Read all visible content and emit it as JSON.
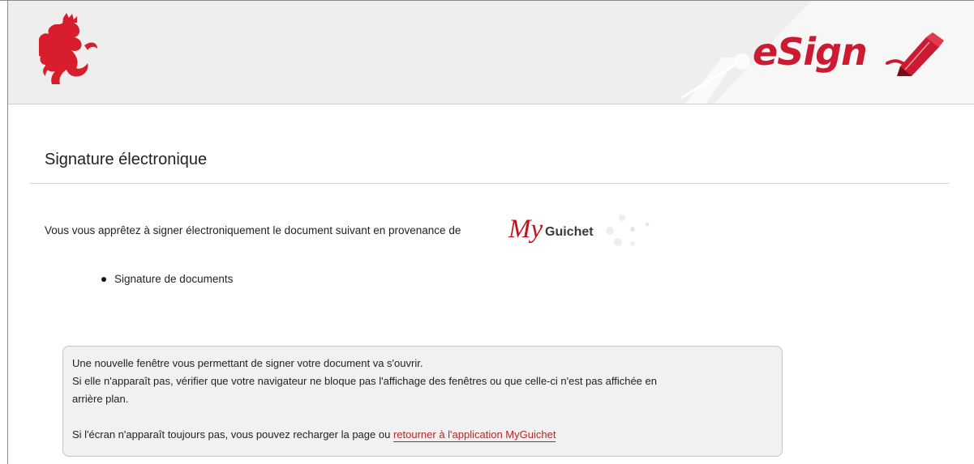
{
  "header": {
    "logo_alt": "Luxembourg red lion",
    "esign_logo": {
      "text": "eSign",
      "color": "#cc1a32"
    }
  },
  "main": {
    "title": "Signature électronique",
    "intro": "Vous vous apprêtez à signer électroniquement le document suivant en provenance de",
    "source_logo": {
      "my": "My",
      "guichet": "Guichet"
    },
    "documents": [
      "Signature de documents"
    ]
  },
  "info_box": {
    "line1": "Une nouvelle fenêtre vous permettant de signer votre document va s'ouvrir.",
    "line2": "Si elle n'apparaît pas, vérifier que votre navigateur ne bloque pas l'affichage des fenêtres ou que celle-ci n'est pas affichée en",
    "line3": "arrière plan.",
    "line4_prefix": "Si l'écran n'apparaît toujours pas, vous pouvez recharger la page ou",
    "return_link": "retourner à l'application MyGuichet"
  },
  "colors": {
    "brand_red": "#cc1a32",
    "link_red": "#b0282c",
    "header_bg": "#eeeeee",
    "box_bg": "#f1f1f1"
  },
  "icons": [
    "lion-icon",
    "pen-icon",
    "bullet-icon"
  ]
}
